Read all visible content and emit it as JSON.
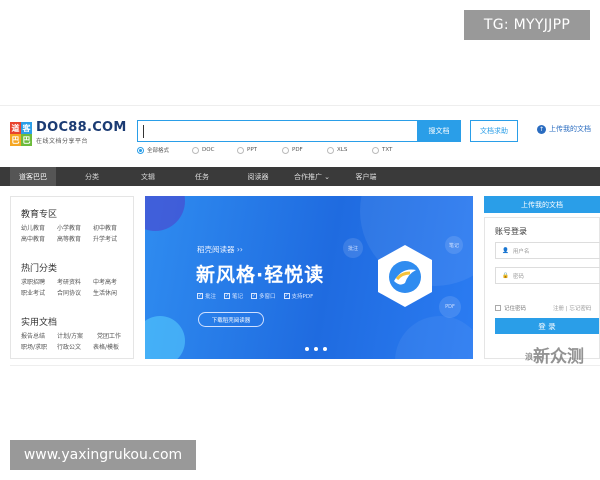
{
  "watermarks": {
    "tg": "TG: MYYJJPP",
    "url": "www.yaxingrukou.com",
    "corner": "新众测",
    "corner_sub": "浪"
  },
  "logo": {
    "mark": [
      "道",
      "客",
      "巴",
      "巴"
    ],
    "name": "DOC88.COM",
    "tagline": "在线文档分享平台"
  },
  "search": {
    "value": "",
    "button": "搜文档"
  },
  "header": {
    "help": "文档求助",
    "upload": "上传我的文档"
  },
  "filters": [
    {
      "label": "全部格式",
      "selected": true
    },
    {
      "label": "DOC",
      "selected": false
    },
    {
      "label": "PPT",
      "selected": false
    },
    {
      "label": "PDF",
      "selected": false
    },
    {
      "label": "XLS",
      "selected": false
    },
    {
      "label": "TXT",
      "selected": false
    }
  ],
  "nav": [
    "道客巴巴",
    "分类",
    "文辑",
    "任务",
    "阅读器",
    "合作推广 ⌄",
    "客户端"
  ],
  "categories": [
    {
      "title": "教育专区",
      "links": [
        "幼儿教育",
        "小学教育",
        "初中教育",
        "高中教育",
        "高等教育",
        "升学考试"
      ]
    },
    {
      "title": "热门分类",
      "links": [
        "求职招聘",
        "考研资料",
        "中考高考",
        "职业考试",
        "合同协议",
        "生活休闲"
      ]
    },
    {
      "title": "实用文档",
      "links": [
        "报告总结",
        "计划/方案",
        "党团工作",
        "职场/求职",
        "行政公文",
        "表格/模板"
      ]
    }
  ],
  "banner": {
    "app_name": "稻壳阅读器 ››",
    "headline": "新风格·轻悦读",
    "features": [
      "批注",
      "笔记",
      "多窗口",
      "支持PDF"
    ],
    "download": "下载稻壳阅读器",
    "tags": [
      "批注",
      "笔记",
      "PDF"
    ]
  },
  "sidebar": {
    "upload": "上传我的文档",
    "login_title": "账号登录",
    "username": "用户名",
    "password": "密码",
    "remember": "记住密码",
    "links": "注册 | 忘记密码",
    "login_button": "登 录"
  },
  "colors": {
    "accent": "#2a9ee8",
    "nav_bg": "#3a3a3a",
    "logo": "#1b3b73",
    "banner": "#1f6be0"
  }
}
